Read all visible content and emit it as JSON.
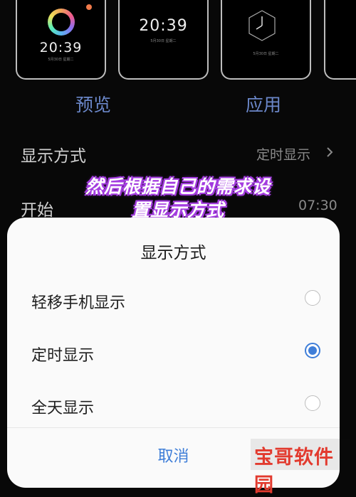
{
  "previews": [
    {
      "time": "20:39",
      "date": "5月30日 星期二"
    },
    {
      "time": "20:39",
      "date": "5月30日 星期二"
    },
    {
      "time": "",
      "date": "5月30日 星期二"
    }
  ],
  "tabs": {
    "preview": "预览",
    "apply": "应用"
  },
  "settings": {
    "display_mode_label": "显示方式",
    "display_mode_value": "定时显示",
    "start_label": "开始",
    "start_value": "07:30"
  },
  "overlay_caption": {
    "line1": "然后根据自己的需求设",
    "line2": "置显示方式"
  },
  "sheet": {
    "title": "显示方式",
    "options": [
      {
        "label": "轻移手机显示",
        "selected": false
      },
      {
        "label": "定时显示",
        "selected": true
      },
      {
        "label": "全天显示",
        "selected": false
      }
    ],
    "cancel": "取消"
  },
  "watermark": "宝哥软件园",
  "colors": {
    "accent": "#3f7ed8",
    "tab": "#6b87c9",
    "caption_glow": "#a43ce0",
    "watermark": "#e23a2e"
  }
}
